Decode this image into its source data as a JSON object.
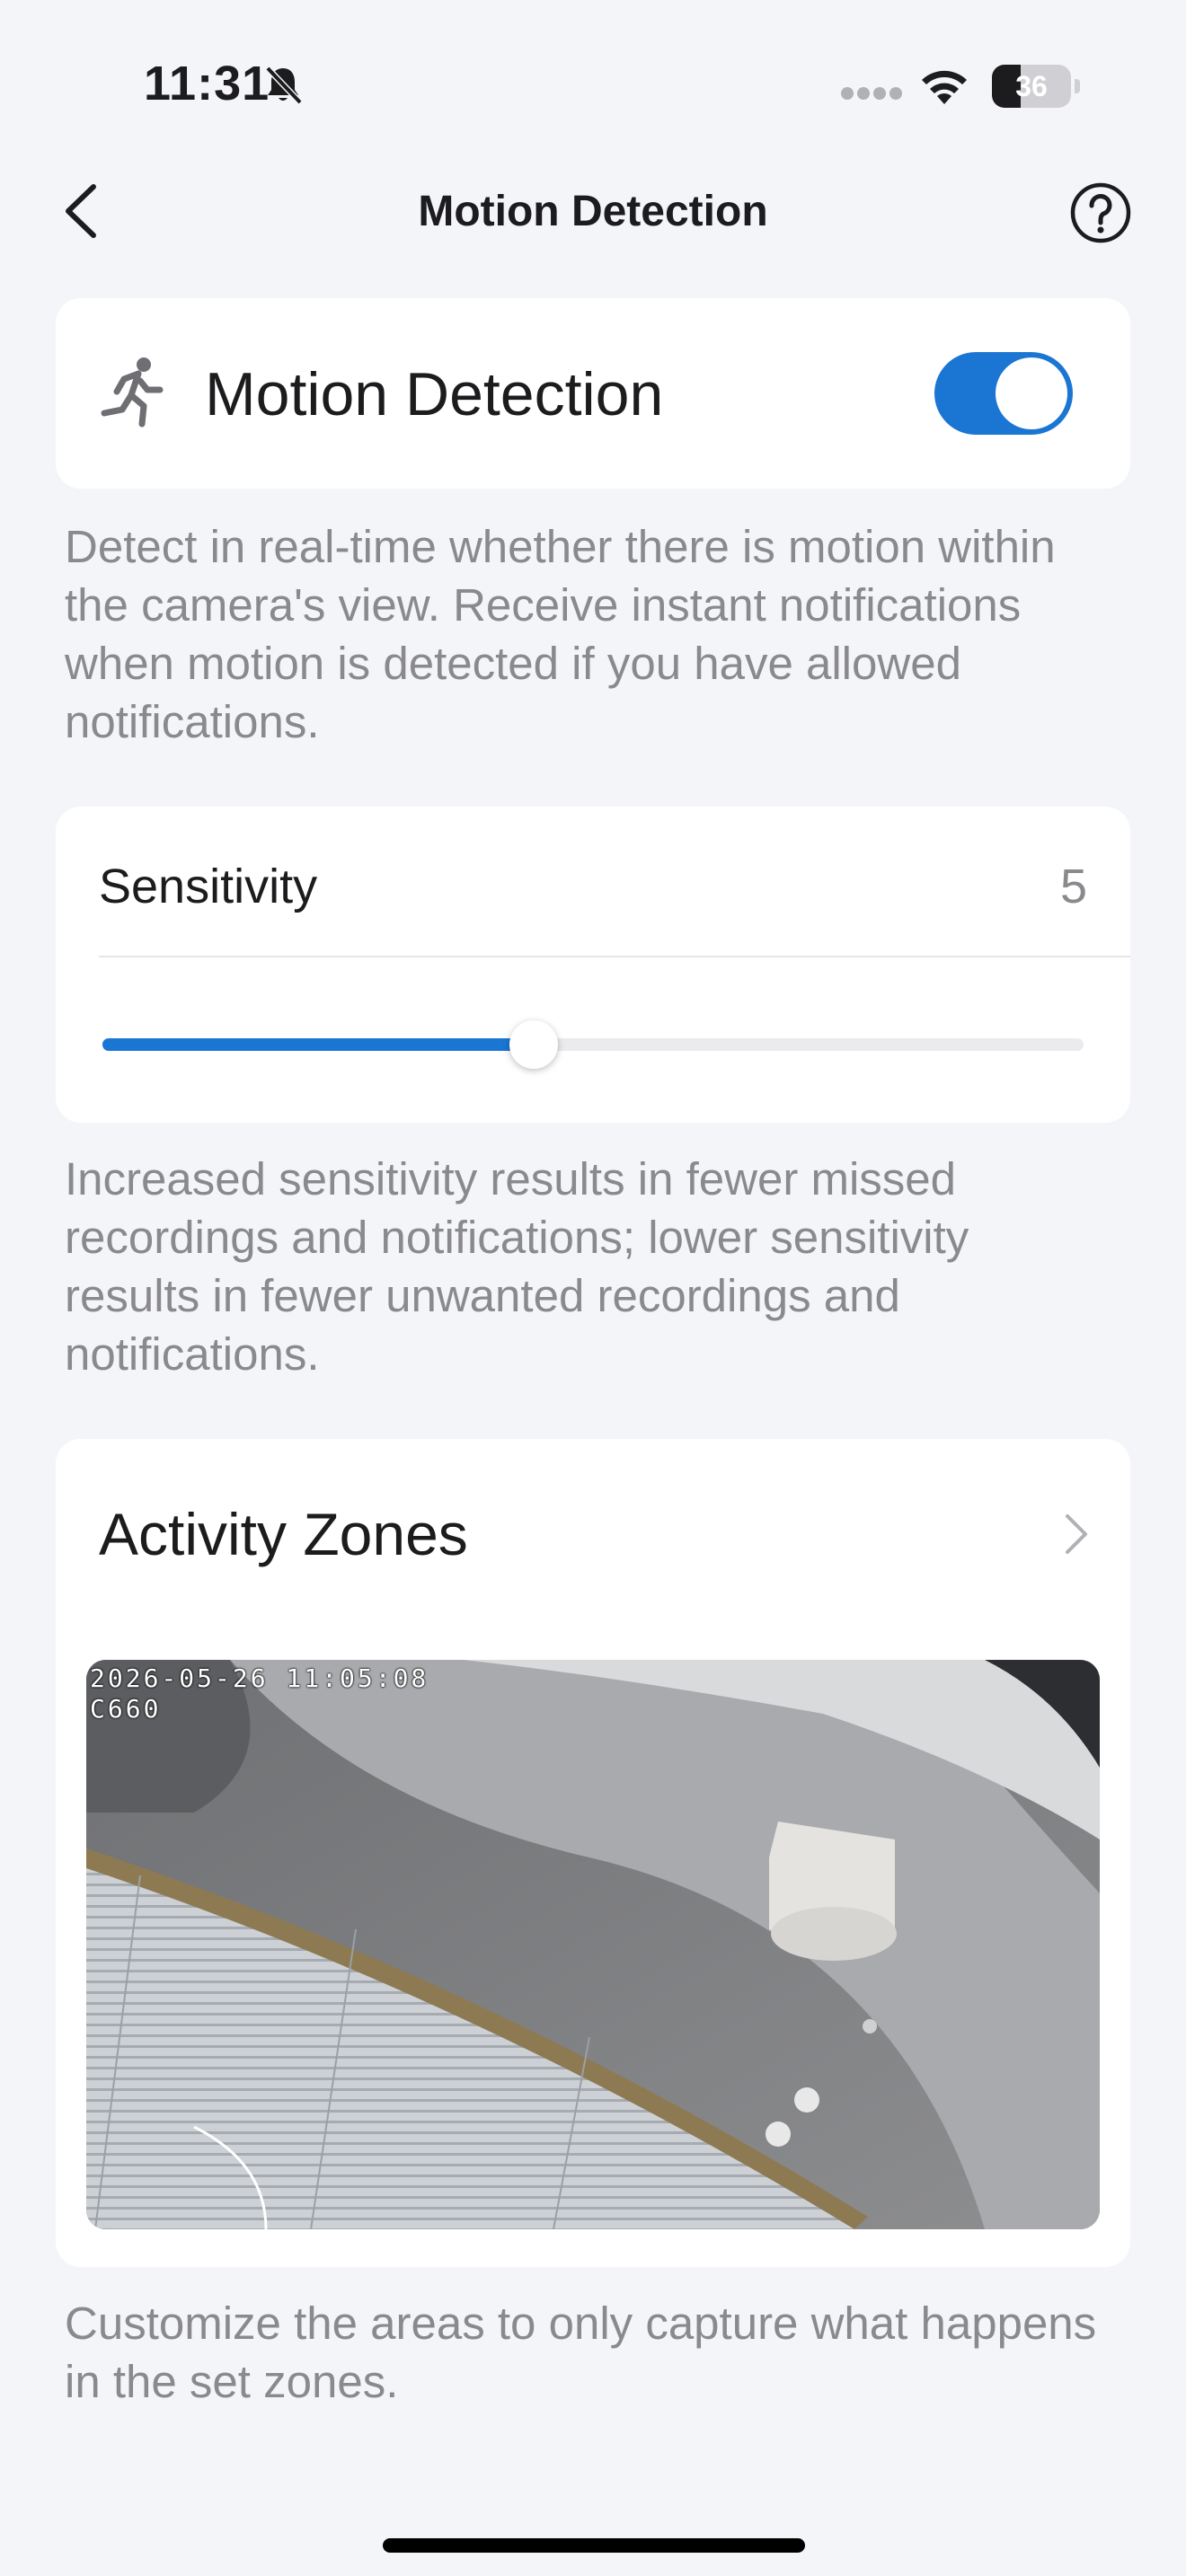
{
  "status_bar": {
    "time": "11:31",
    "battery_level": "36",
    "battery_fraction": 0.36,
    "icons": [
      "bell-slash-icon",
      "cellular-signal-icon",
      "wifi-icon",
      "battery-icon"
    ]
  },
  "nav": {
    "title": "Motion Detection",
    "back_icon": "chevron-left-icon",
    "help_icon": "question-circle-icon"
  },
  "motion_detection": {
    "label": "Motion Detection",
    "icon": "running-person-icon",
    "enabled": true,
    "description": "Detect in real-time whether there is motion within the camera's view. Receive instant notifications when motion is detected if you have allowed notifications."
  },
  "sensitivity": {
    "label": "Sensitivity",
    "value": "5",
    "level_fraction": 0.44,
    "description": "Increased sensitivity results in fewer missed recordings and notifications; lower sensitivity results in fewer unwanted recordings and notifications."
  },
  "activity_zones": {
    "label": "Activity Zones",
    "chevron_icon": "chevron-right-icon",
    "camera_timestamp": "2026-05-26 11:05:08",
    "camera_name": "C660",
    "description": "Customize the areas to only capture what happens in the set zones."
  },
  "colors": {
    "accent": "#1a76d2",
    "background": "#f4f5f9",
    "secondary_text": "#8a8a8e"
  }
}
